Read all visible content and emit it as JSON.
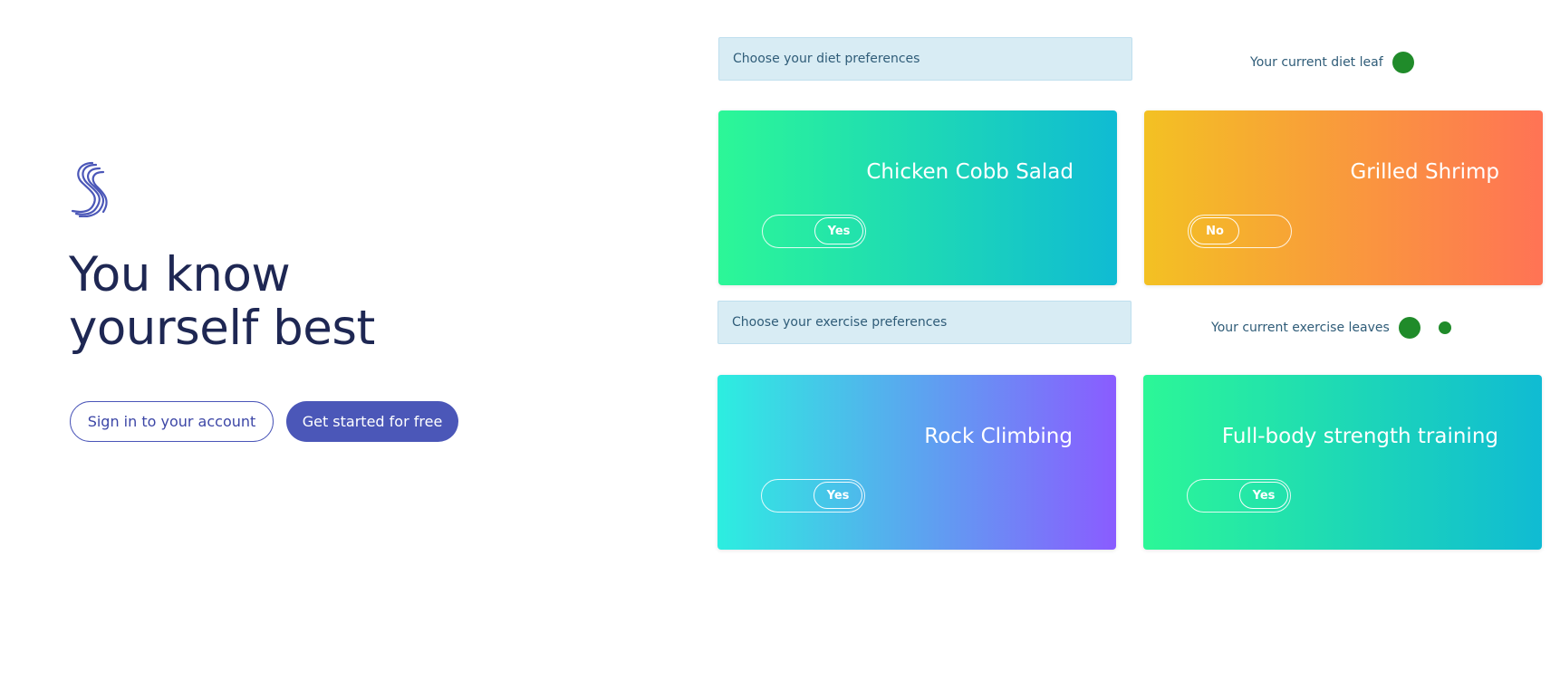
{
  "hero": {
    "headline_line1": "You know",
    "headline_line2": "yourself best",
    "signin_label": "Sign in to your account",
    "getstarted_label": "Get started for free"
  },
  "diet": {
    "label": "Choose your diet preferences",
    "leaf_status": "Your current diet leaf",
    "leaf_count": 1,
    "cards": [
      {
        "title": "Chicken Cobb Salad",
        "toggle": "Yes"
      },
      {
        "title": "Grilled Shrimp",
        "toggle": "No"
      }
    ]
  },
  "exercise": {
    "label": "Choose your exercise preferences",
    "leaf_status": "Your current exercise leaves",
    "leaf_count": 2,
    "cards": [
      {
        "title": "Rock Climbing",
        "toggle": "Yes"
      },
      {
        "title": "Full-body strength training",
        "toggle": "Yes"
      }
    ]
  },
  "colors": {
    "brand": "#4b57b8",
    "headline": "#1e2753",
    "leaf": "#208b2a",
    "green_teal_gradient": [
      "#2cf797",
      "#10bbd3"
    ],
    "orange_gradient": [
      "#f3c123",
      "#ff7355"
    ],
    "cyan_purple_gradient": [
      "#2ceee0",
      "#8a5cff"
    ]
  },
  "icons": {
    "logo": "stacked-s-logo-icon",
    "leaf": "leaf-dot-icon"
  }
}
